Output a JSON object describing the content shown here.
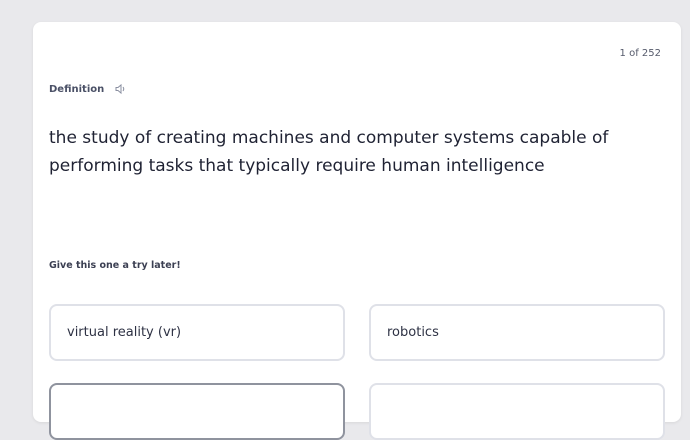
{
  "counter": "1 of 252",
  "term_label": "Definition",
  "definition": "the study of creating machines and computer systems capable of performing tasks that typically require human intelligence",
  "hint": "Give this one a try later!",
  "options": [
    {
      "label": "virtual reality (vr)"
    },
    {
      "label": "robotics"
    },
    {
      "label": ""
    },
    {
      "label": ""
    }
  ]
}
